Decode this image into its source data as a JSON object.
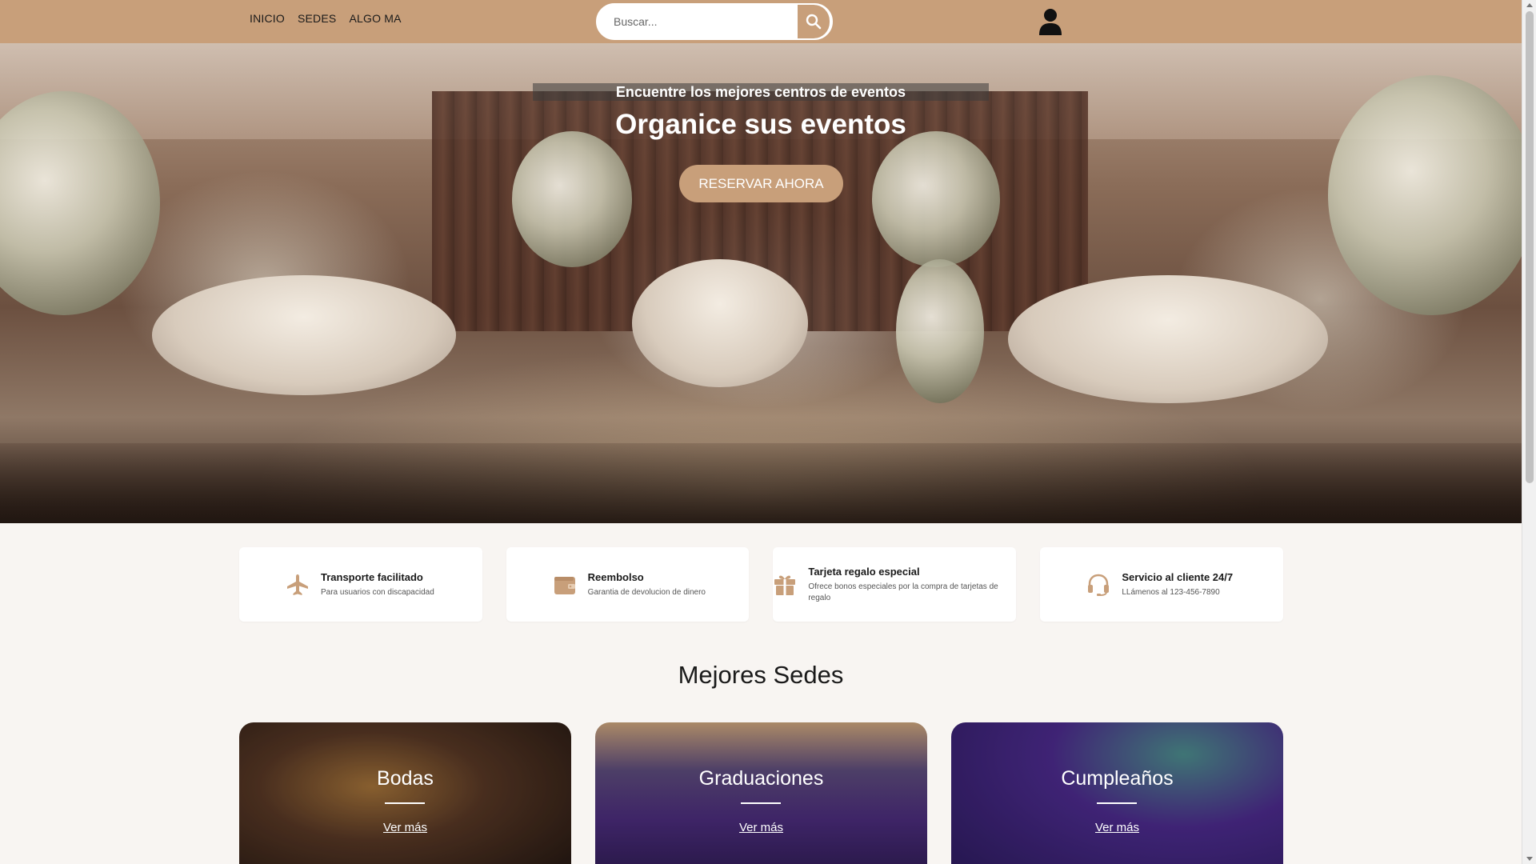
{
  "nav": {
    "links": [
      "INICIO",
      "SEDES",
      "ALGO MA"
    ],
    "search_placeholder": "Buscar...",
    "search_icon": "search-icon",
    "user_icon": "user-icon"
  },
  "hero": {
    "subtitle": "Encuentre los mejores centros de eventos",
    "title": "Organice sus eventos",
    "cta_label": "RESERVAR AHORA"
  },
  "features": [
    {
      "icon": "plane-icon",
      "title": "Transporte facilitado",
      "desc": "Para usuarios con discapacidad"
    },
    {
      "icon": "wallet-icon",
      "title": "Reembolso",
      "desc": "Garantia de devolucion de dinero"
    },
    {
      "icon": "gift-icon",
      "title": "Tarjeta regalo especial",
      "desc": "Ofrece bonos especiales por la compra de tarjetas de regalo"
    },
    {
      "icon": "headset-icon",
      "title": "Servicio al cliente 24/7",
      "desc": "LLámenos al 123-456-7890"
    }
  ],
  "section": {
    "title": "Mejores Sedes"
  },
  "venues": [
    {
      "title": "Bodas",
      "link": "Ver más"
    },
    {
      "title": "Graduaciones",
      "link": "Ver más"
    },
    {
      "title": "Cumpleaños",
      "link": "Ver más"
    }
  ],
  "colors": {
    "accent": "#c89f7a",
    "background": "#f8f5f2"
  }
}
